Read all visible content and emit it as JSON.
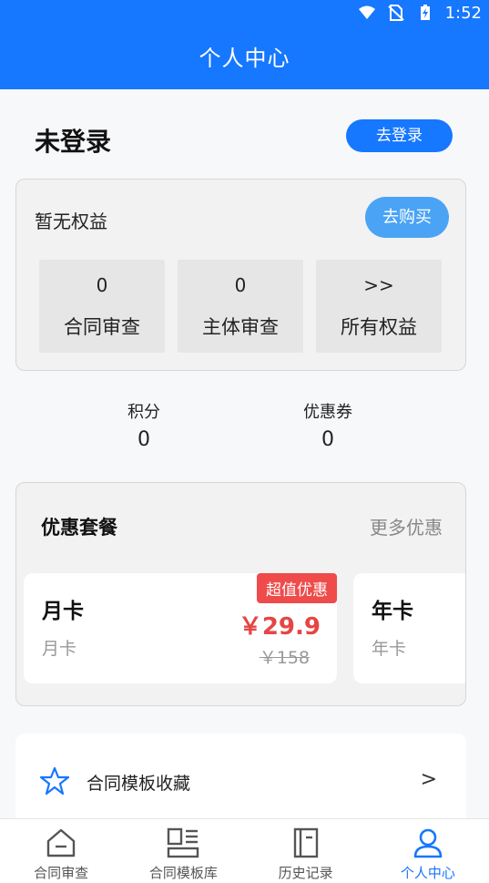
{
  "status_bar": {
    "time": "1:52"
  },
  "header": {
    "title": "个人中心"
  },
  "login": {
    "status_text": "未登录",
    "button_label": "去登录"
  },
  "rights": {
    "title": "暂无权益",
    "buy_label": "去购买",
    "items": [
      {
        "value": "0",
        "label": "合同审查"
      },
      {
        "value": "0",
        "label": "主体审查"
      },
      {
        "value": ">>",
        "label": "所有权益"
      }
    ]
  },
  "points": {
    "label": "积分",
    "value": "0"
  },
  "coupons": {
    "label": "优惠券",
    "value": "0"
  },
  "packages": {
    "title": "优惠套餐",
    "more_label": "更多优惠",
    "items": [
      {
        "name": "月卡",
        "desc": "月卡",
        "badge": "超值优惠",
        "price": "￥29.9",
        "orig_price": "￥158"
      },
      {
        "name": "年卡",
        "desc": "年卡"
      }
    ]
  },
  "favorites": {
    "label": "合同模板收藏",
    "arrow": ">"
  },
  "tabbar": {
    "items": [
      {
        "label": "合同审查",
        "icon": "home-icon"
      },
      {
        "label": "合同模板库",
        "icon": "template-icon"
      },
      {
        "label": "历史记录",
        "icon": "history-icon"
      },
      {
        "label": "个人中心",
        "icon": "user-icon"
      }
    ],
    "active_color": "#1677ff"
  },
  "colors": {
    "brand": "#1677ff",
    "price": "#e64545",
    "badge": "#ef4b4b"
  }
}
